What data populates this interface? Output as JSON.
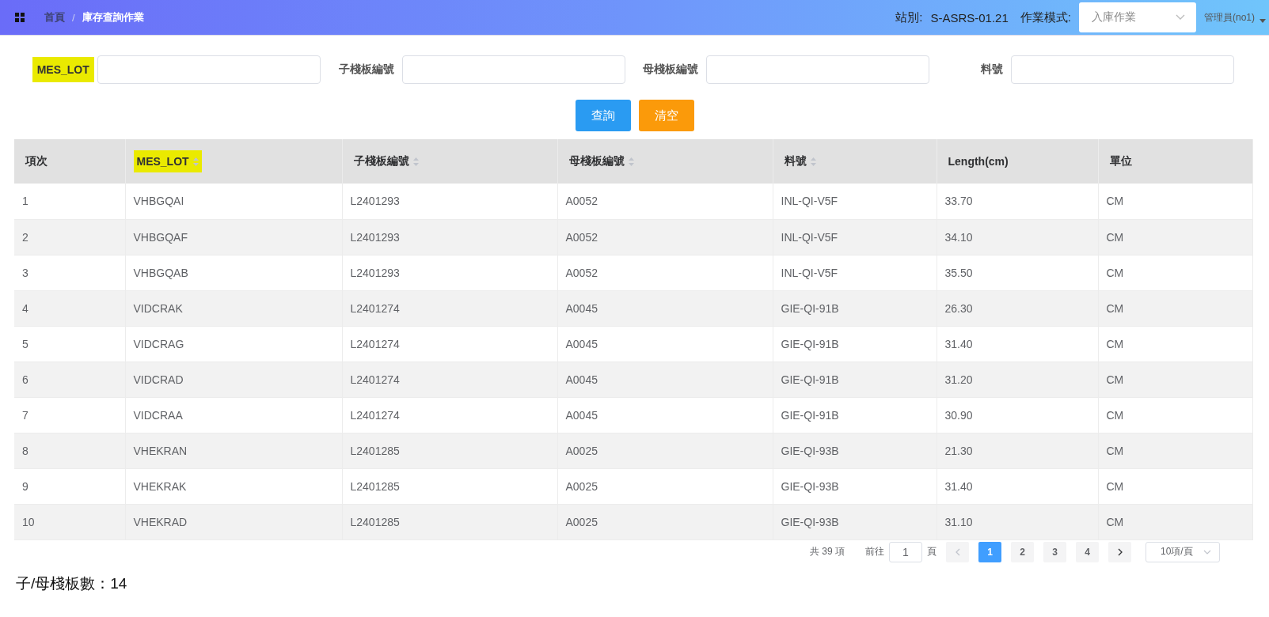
{
  "header": {
    "breadcrumb": [
      "首頁",
      "庫存查詢作業"
    ],
    "separator": "/",
    "station_label": "站別:",
    "station": "S-ASRS-01.21",
    "mode_label": "作業模式:",
    "mode": "入庫作業",
    "user": "管理員(no1)"
  },
  "filters": [
    {
      "label": "MES_LOT",
      "highlighted": true
    },
    {
      "label": "子棧板編號",
      "highlighted": false
    },
    {
      "label": "母棧板編號",
      "highlighted": false
    },
    {
      "label": "料號",
      "highlighted": false
    }
  ],
  "buttons": [
    {
      "label": "查詢",
      "kind": "primary"
    },
    {
      "label": "清空",
      "kind": "warning"
    }
  ],
  "table": {
    "columns": [
      {
        "label": "項次",
        "sortable": false,
        "highlighted": false
      },
      {
        "label": "MES_LOT",
        "sortable": true,
        "highlighted": true
      },
      {
        "label": "子棧板編號",
        "sortable": true,
        "highlighted": false
      },
      {
        "label": "母棧板編號",
        "sortable": true,
        "highlighted": false
      },
      {
        "label": "料號",
        "sortable": true,
        "highlighted": false
      },
      {
        "label": "Length(cm)",
        "sortable": false,
        "highlighted": false
      },
      {
        "label": "單位",
        "sortable": false,
        "highlighted": false
      }
    ],
    "rows": [
      [
        "1",
        "VHBGQAI",
        "L2401293",
        "A0052",
        "INL-QI-V5F",
        "33.70",
        "CM"
      ],
      [
        "2",
        "VHBGQAF",
        "L2401293",
        "A0052",
        "INL-QI-V5F",
        "34.10",
        "CM"
      ],
      [
        "3",
        "VHBGQAB",
        "L2401293",
        "A0052",
        "INL-QI-V5F",
        "35.50",
        "CM"
      ],
      [
        "4",
        "VIDCRAK",
        "L2401274",
        "A0045",
        "GIE-QI-91B",
        "26.30",
        "CM"
      ],
      [
        "5",
        "VIDCRAG",
        "L2401274",
        "A0045",
        "GIE-QI-91B",
        "31.40",
        "CM"
      ],
      [
        "6",
        "VIDCRAD",
        "L2401274",
        "A0045",
        "GIE-QI-91B",
        "31.20",
        "CM"
      ],
      [
        "7",
        "VIDCRAA",
        "L2401274",
        "A0045",
        "GIE-QI-91B",
        "30.90",
        "CM"
      ],
      [
        "8",
        "VHEKRAN",
        "L2401285",
        "A0025",
        "GIE-QI-93B",
        "21.30",
        "CM"
      ],
      [
        "9",
        "VHEKRAK",
        "L2401285",
        "A0025",
        "GIE-QI-93B",
        "31.40",
        "CM"
      ],
      [
        "10",
        "VHEKRAD",
        "L2401285",
        "A0025",
        "GIE-QI-93B",
        "31.10",
        "CM"
      ]
    ]
  },
  "pagination": {
    "total": "共 39 項",
    "goto_label": "前往",
    "goto_value": "1",
    "goto_suffix": "頁",
    "pages": [
      {
        "label": "1",
        "selected": true
      },
      {
        "label": "2",
        "selected": false
      },
      {
        "label": "3",
        "selected": false
      },
      {
        "label": "4",
        "selected": false
      }
    ],
    "page_size": "10項/頁"
  },
  "summary": "子/母棧板數：14"
}
